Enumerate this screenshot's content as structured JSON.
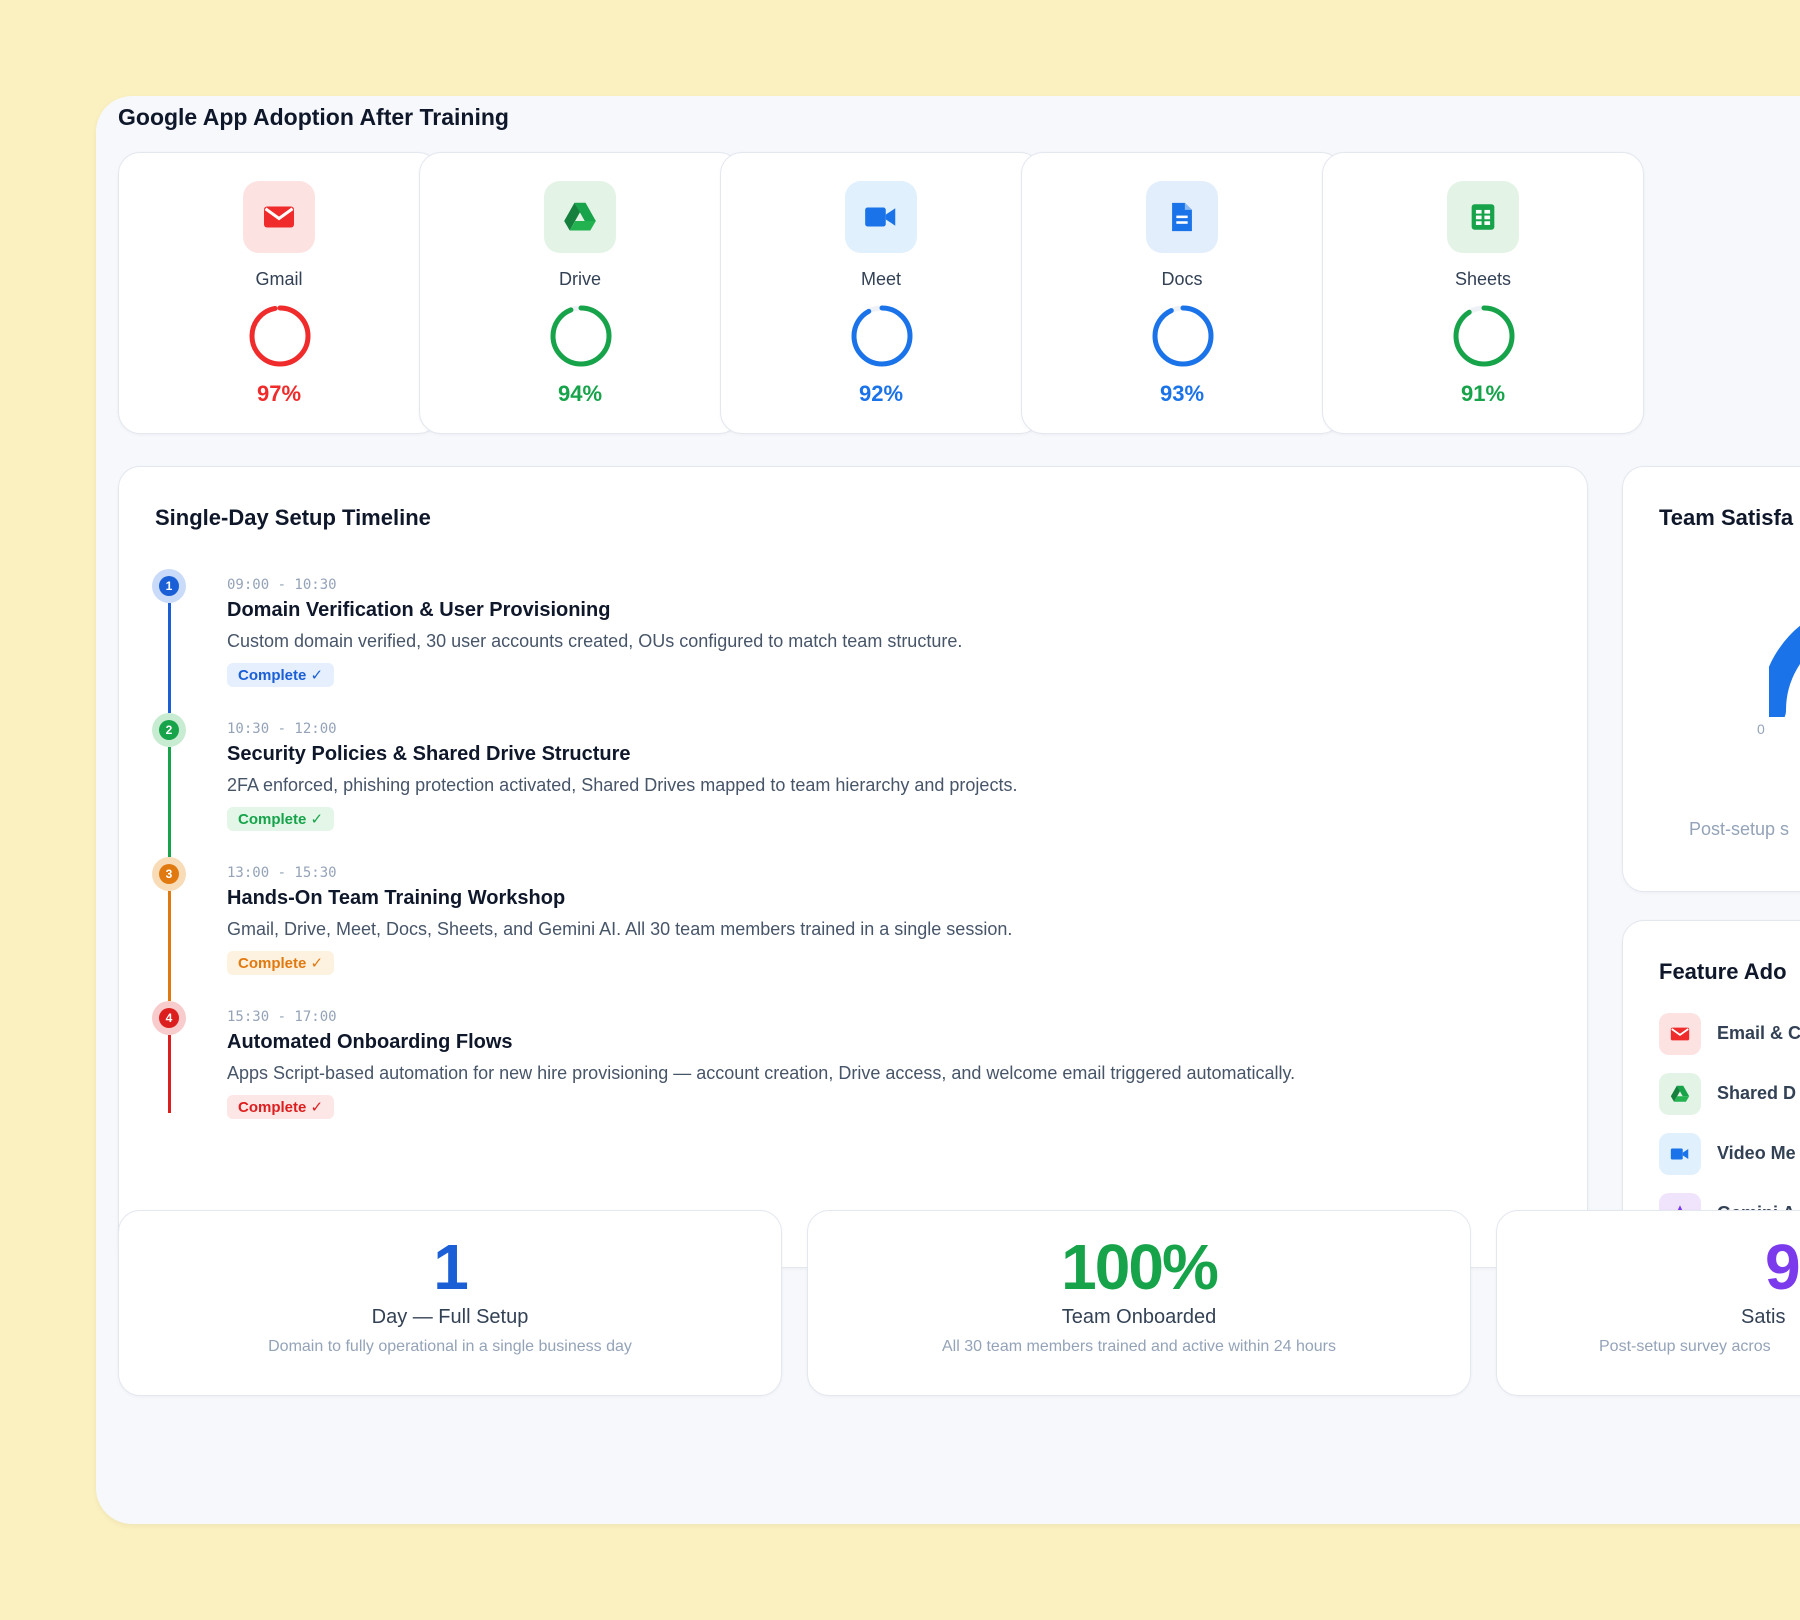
{
  "header": {
    "title": "Google App Adoption After Training"
  },
  "apps": [
    {
      "name": "Gmail",
      "pct_label": "97%",
      "pct": 97,
      "color": "#ef2b2b",
      "icon_bg": "#fde2e2",
      "icon": "mail-icon"
    },
    {
      "name": "Drive",
      "pct_label": "94%",
      "pct": 94,
      "color": "#16a34a",
      "icon_bg": "#e3f3e6",
      "icon": "drive-icon"
    },
    {
      "name": "Meet",
      "pct_label": "92%",
      "pct": 92,
      "color": "#1a73e8",
      "icon_bg": "#e0f0fd",
      "icon": "video-camera-icon"
    },
    {
      "name": "Docs",
      "pct_label": "93%",
      "pct": 93,
      "color": "#1a73e8",
      "icon_bg": "#e3eefc",
      "icon": "document-icon"
    },
    {
      "name": "Sheets",
      "pct_label": "91%",
      "pct": 91,
      "color": "#16a34a",
      "icon_bg": "#e3f3e6",
      "icon": "spreadsheet-icon"
    }
  ],
  "timeline": {
    "title": "Single-Day Setup Timeline",
    "items": [
      {
        "step": "1",
        "time": "09:00 - 10:30",
        "title": "Domain Verification & User Provisioning",
        "desc": "Custom domain verified, 30 user accounts created, OUs configured to match team structure.",
        "badge": "Complete ✓",
        "color": "#1a5fd6",
        "badge_bg": "#e6effd",
        "halo": "#c9dbf8"
      },
      {
        "step": "2",
        "time": "10:30 - 12:00",
        "title": "Security Policies & Shared Drive Structure",
        "desc": "2FA enforced, phishing protection activated, Shared Drives mapped to team hierarchy and projects.",
        "badge": "Complete ✓",
        "color": "#16a34a",
        "badge_bg": "#e3f6e8",
        "halo": "#c8ecd2"
      },
      {
        "step": "3",
        "time": "13:00 - 15:30",
        "title": "Hands-On Team Training Workshop",
        "desc": "Gmail, Drive, Meet, Docs, Sheets, and Gemini AI. All 30 team members trained in a single session.",
        "badge": "Complete ✓",
        "color": "#e07a10",
        "badge_bg": "#fdf1df",
        "halo": "#f8dcb8"
      },
      {
        "step": "4",
        "time": "15:30 - 17:00",
        "title": "Automated Onboarding Flows",
        "desc": "Apps Script-based automation for new hire provisioning — account creation, Drive access, and welcome email triggered automatically.",
        "badge": "Complete ✓",
        "color": "#dc1e1e",
        "badge_bg": "#fde6e6",
        "halo": "#f8cccc"
      }
    ]
  },
  "satisfaction": {
    "title": "Team Satisfa",
    "gauge_min": "0",
    "caption": "Post-setup s",
    "gauge_color": "#1a73e8"
  },
  "features": {
    "title": "Feature Ado",
    "items": [
      {
        "label": "Email & C",
        "icon": "mail-icon",
        "color": "#ef2b2b",
        "bg": "#fde2e2"
      },
      {
        "label": "Shared D",
        "icon": "drive-icon",
        "color": "#16a34a",
        "bg": "#e3f3e6"
      },
      {
        "label": "Video Me",
        "icon": "video-camera-icon",
        "color": "#1a73e8",
        "bg": "#e0f0fd"
      },
      {
        "label": "Gemini A",
        "icon": "star-icon",
        "color": "#7c3aed",
        "bg": "#efe4fc"
      }
    ]
  },
  "stats": [
    {
      "value": "1",
      "label": "Day — Full Setup",
      "sub": "Domain to fully operational in a single business day",
      "color": "#1a5fd6"
    },
    {
      "value": "100%",
      "label": "Team Onboarded",
      "sub": "All 30 team members trained and active within 24 hours",
      "color": "#16a34a"
    },
    {
      "value": "9",
      "label": "Satis",
      "sub": "Post-setup survey acros",
      "color": "#7c3aed"
    }
  ]
}
